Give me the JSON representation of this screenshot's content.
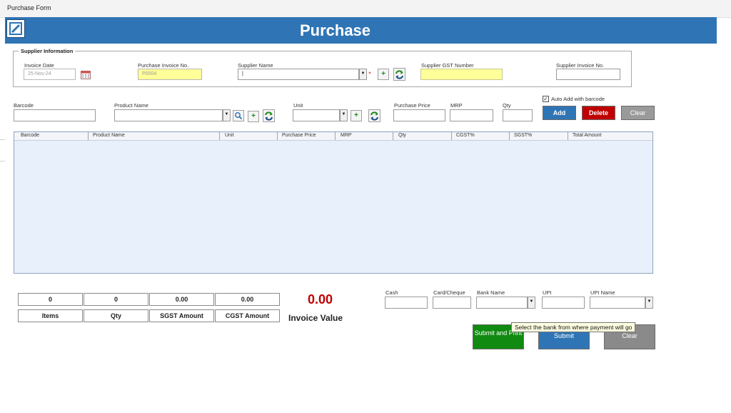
{
  "window": {
    "title": "Purchase Form"
  },
  "header": {
    "title": "Purchase",
    "icon": "edit-document-icon",
    "band_color": "#2f75b5"
  },
  "supplier_section": {
    "legend": "Supplier Information",
    "invoice_date": {
      "label": "Invoice Date",
      "value": "25-Nov-24",
      "icon": "calendar-icon"
    },
    "purchase_invoice_no": {
      "label": "Purchase Invoice No.",
      "value": "P0004"
    },
    "supplier_name": {
      "label": "Supplier Name",
      "value": "|",
      "required_mark": "*"
    },
    "supplier_gst": {
      "label": "Supplier GST Number",
      "value": ""
    },
    "supplier_invoice_no": {
      "label": "Supplier Invoice No.",
      "value": ""
    }
  },
  "product_entry": {
    "barcode": {
      "label": "Barcode",
      "value": ""
    },
    "product_name": {
      "label": "Product Name",
      "value": ""
    },
    "unit": {
      "label": "Unit",
      "value": ""
    },
    "purchase_price": {
      "label": "Purchase Price",
      "value": ""
    },
    "mrp": {
      "label": "MRP",
      "value": ""
    },
    "qty": {
      "label": "Qty",
      "value": ""
    },
    "auto_add": {
      "label": "Auto Add with barcode",
      "checked": true
    },
    "buttons": {
      "add": "Add",
      "delete": "Delete",
      "clear": "Clear"
    },
    "button_colors": {
      "add": "#2f75b5",
      "delete": "#c00000",
      "clear": "#9a9a9a"
    }
  },
  "grid": {
    "columns": [
      "Barcode",
      "Product Name",
      "Unit",
      "Purchase Price",
      "MRP",
      "Qty",
      "CGST%",
      "SGST%",
      "Total Amount"
    ],
    "rows": []
  },
  "summary": {
    "items": {
      "value": "0",
      "label": "Items"
    },
    "qty": {
      "value": "0",
      "label": "Qty"
    },
    "sgst": {
      "value": "0.00",
      "label": "SGST Amount"
    },
    "cgst": {
      "value": "0.00",
      "label": "CGST Amount"
    },
    "invoice_value": {
      "value": "0.00",
      "label": "Invoice Value"
    }
  },
  "payment": {
    "cash": {
      "label": "Cash",
      "value": ""
    },
    "card": {
      "label": "Card/Cheque",
      "value": ""
    },
    "bank": {
      "label": "Bank Name",
      "value": ""
    },
    "upi": {
      "label": "UPI",
      "value": ""
    },
    "upi_name": {
      "label": "UPI Name",
      "value": ""
    }
  },
  "actions": {
    "submit_print": "Submit and Print",
    "submit": "Submit",
    "clear": "Clear",
    "colors": {
      "submit_print": "#108a10",
      "submit": "#2f75b5",
      "clear": "#8a8a8a"
    }
  },
  "tooltip": "Select the bank from where payment will go"
}
